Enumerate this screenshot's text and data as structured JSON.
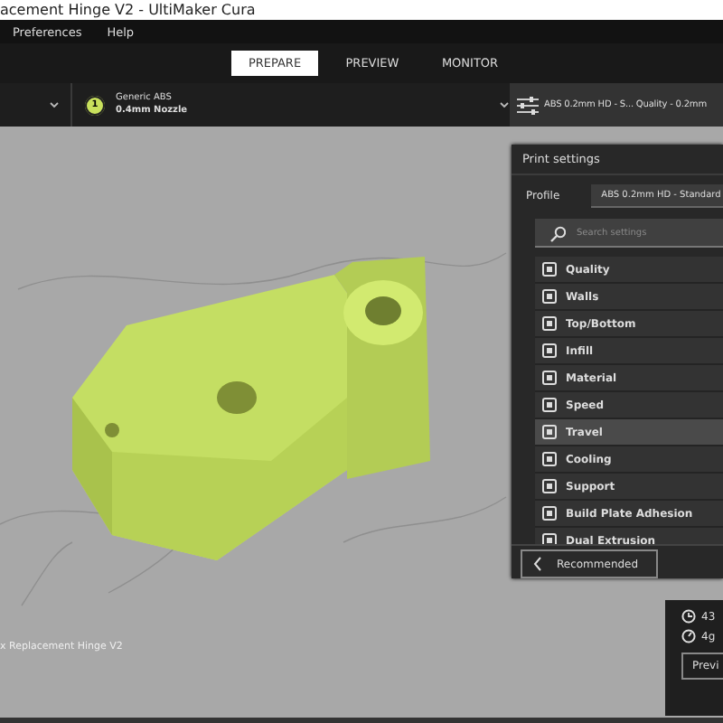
{
  "window": {
    "title": "acement Hinge V2 - UltiMaker Cura"
  },
  "menu": [
    "Preferences",
    "Help"
  ],
  "tabs": [
    {
      "label": "PREPARE",
      "selected": true
    },
    {
      "label": "PREVIEW",
      "selected": false
    },
    {
      "label": "MONITOR",
      "selected": false
    }
  ],
  "toolbar": {
    "extruder_number": "1",
    "material": "Generic ABS",
    "nozzle": "0.4mm Nozzle",
    "profile_summary": "ABS 0.2mm HD - S... Quality - 0.2mm"
  },
  "print_settings": {
    "title": "Print settings",
    "profile_label": "Profile",
    "profile_value": "ABS 0.2mm HD - Standard",
    "search": {
      "placeholder": "Search settings"
    },
    "categories": [
      {
        "label": "Quality",
        "selected": false
      },
      {
        "label": "Walls",
        "selected": false
      },
      {
        "label": "Top/Bottom",
        "selected": false
      },
      {
        "label": "Infill",
        "selected": false
      },
      {
        "label": "Material",
        "selected": false
      },
      {
        "label": "Speed",
        "selected": false
      },
      {
        "label": "Travel",
        "selected": true
      },
      {
        "label": "Cooling",
        "selected": false
      },
      {
        "label": "Support",
        "selected": false
      },
      {
        "label": "Build Plate Adhesion",
        "selected": false
      },
      {
        "label": "Dual Extrusion",
        "selected": false
      }
    ],
    "recommended_button": "Recommended"
  },
  "object_name": "x Replacement Hinge V2",
  "job": {
    "time": "43",
    "weight": "4g",
    "preview_button": "Previ"
  }
}
